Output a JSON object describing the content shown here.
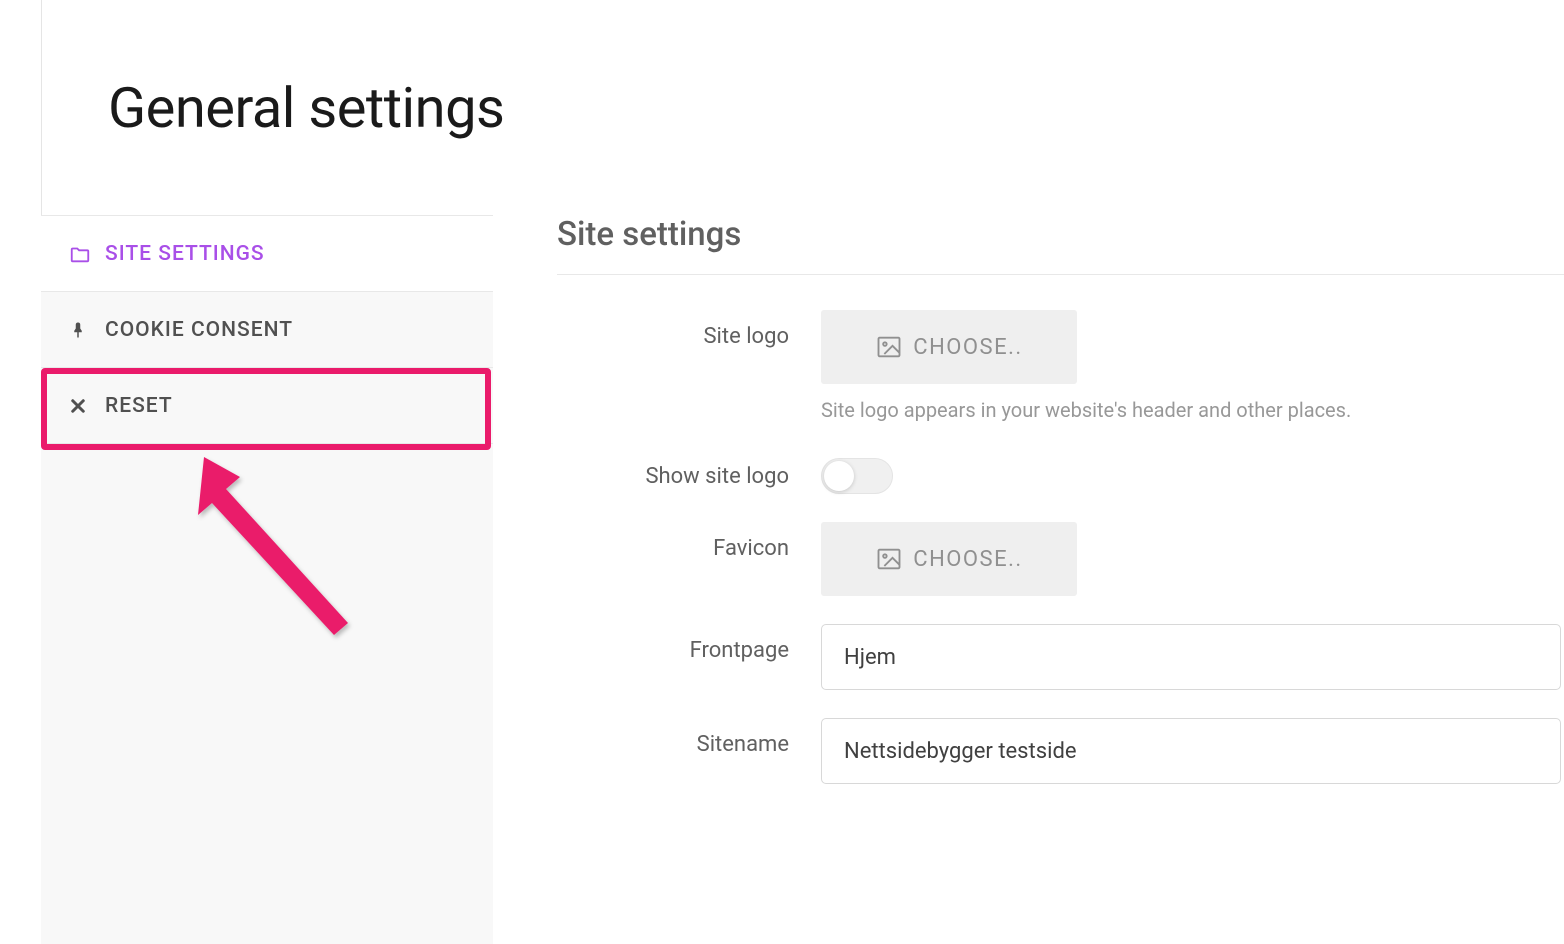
{
  "page": {
    "title": "General settings"
  },
  "sidebar": {
    "items": [
      {
        "label": "SITE SETTINGS"
      },
      {
        "label": "COOKIE CONSENT"
      },
      {
        "label": "RESET"
      }
    ]
  },
  "main": {
    "section_title": "Site settings",
    "rows": {
      "site_logo": {
        "label": "Site logo",
        "button": "CHOOSE..",
        "help": "Site logo appears in your website's header and other places."
      },
      "show_site_logo": {
        "label": "Show site logo"
      },
      "favicon": {
        "label": "Favicon",
        "button": "CHOOSE.."
      },
      "frontpage": {
        "label": "Frontpage",
        "value": "Hjem"
      },
      "sitename": {
        "label": "Sitename",
        "value": "Nettsidebygger testside"
      }
    }
  }
}
